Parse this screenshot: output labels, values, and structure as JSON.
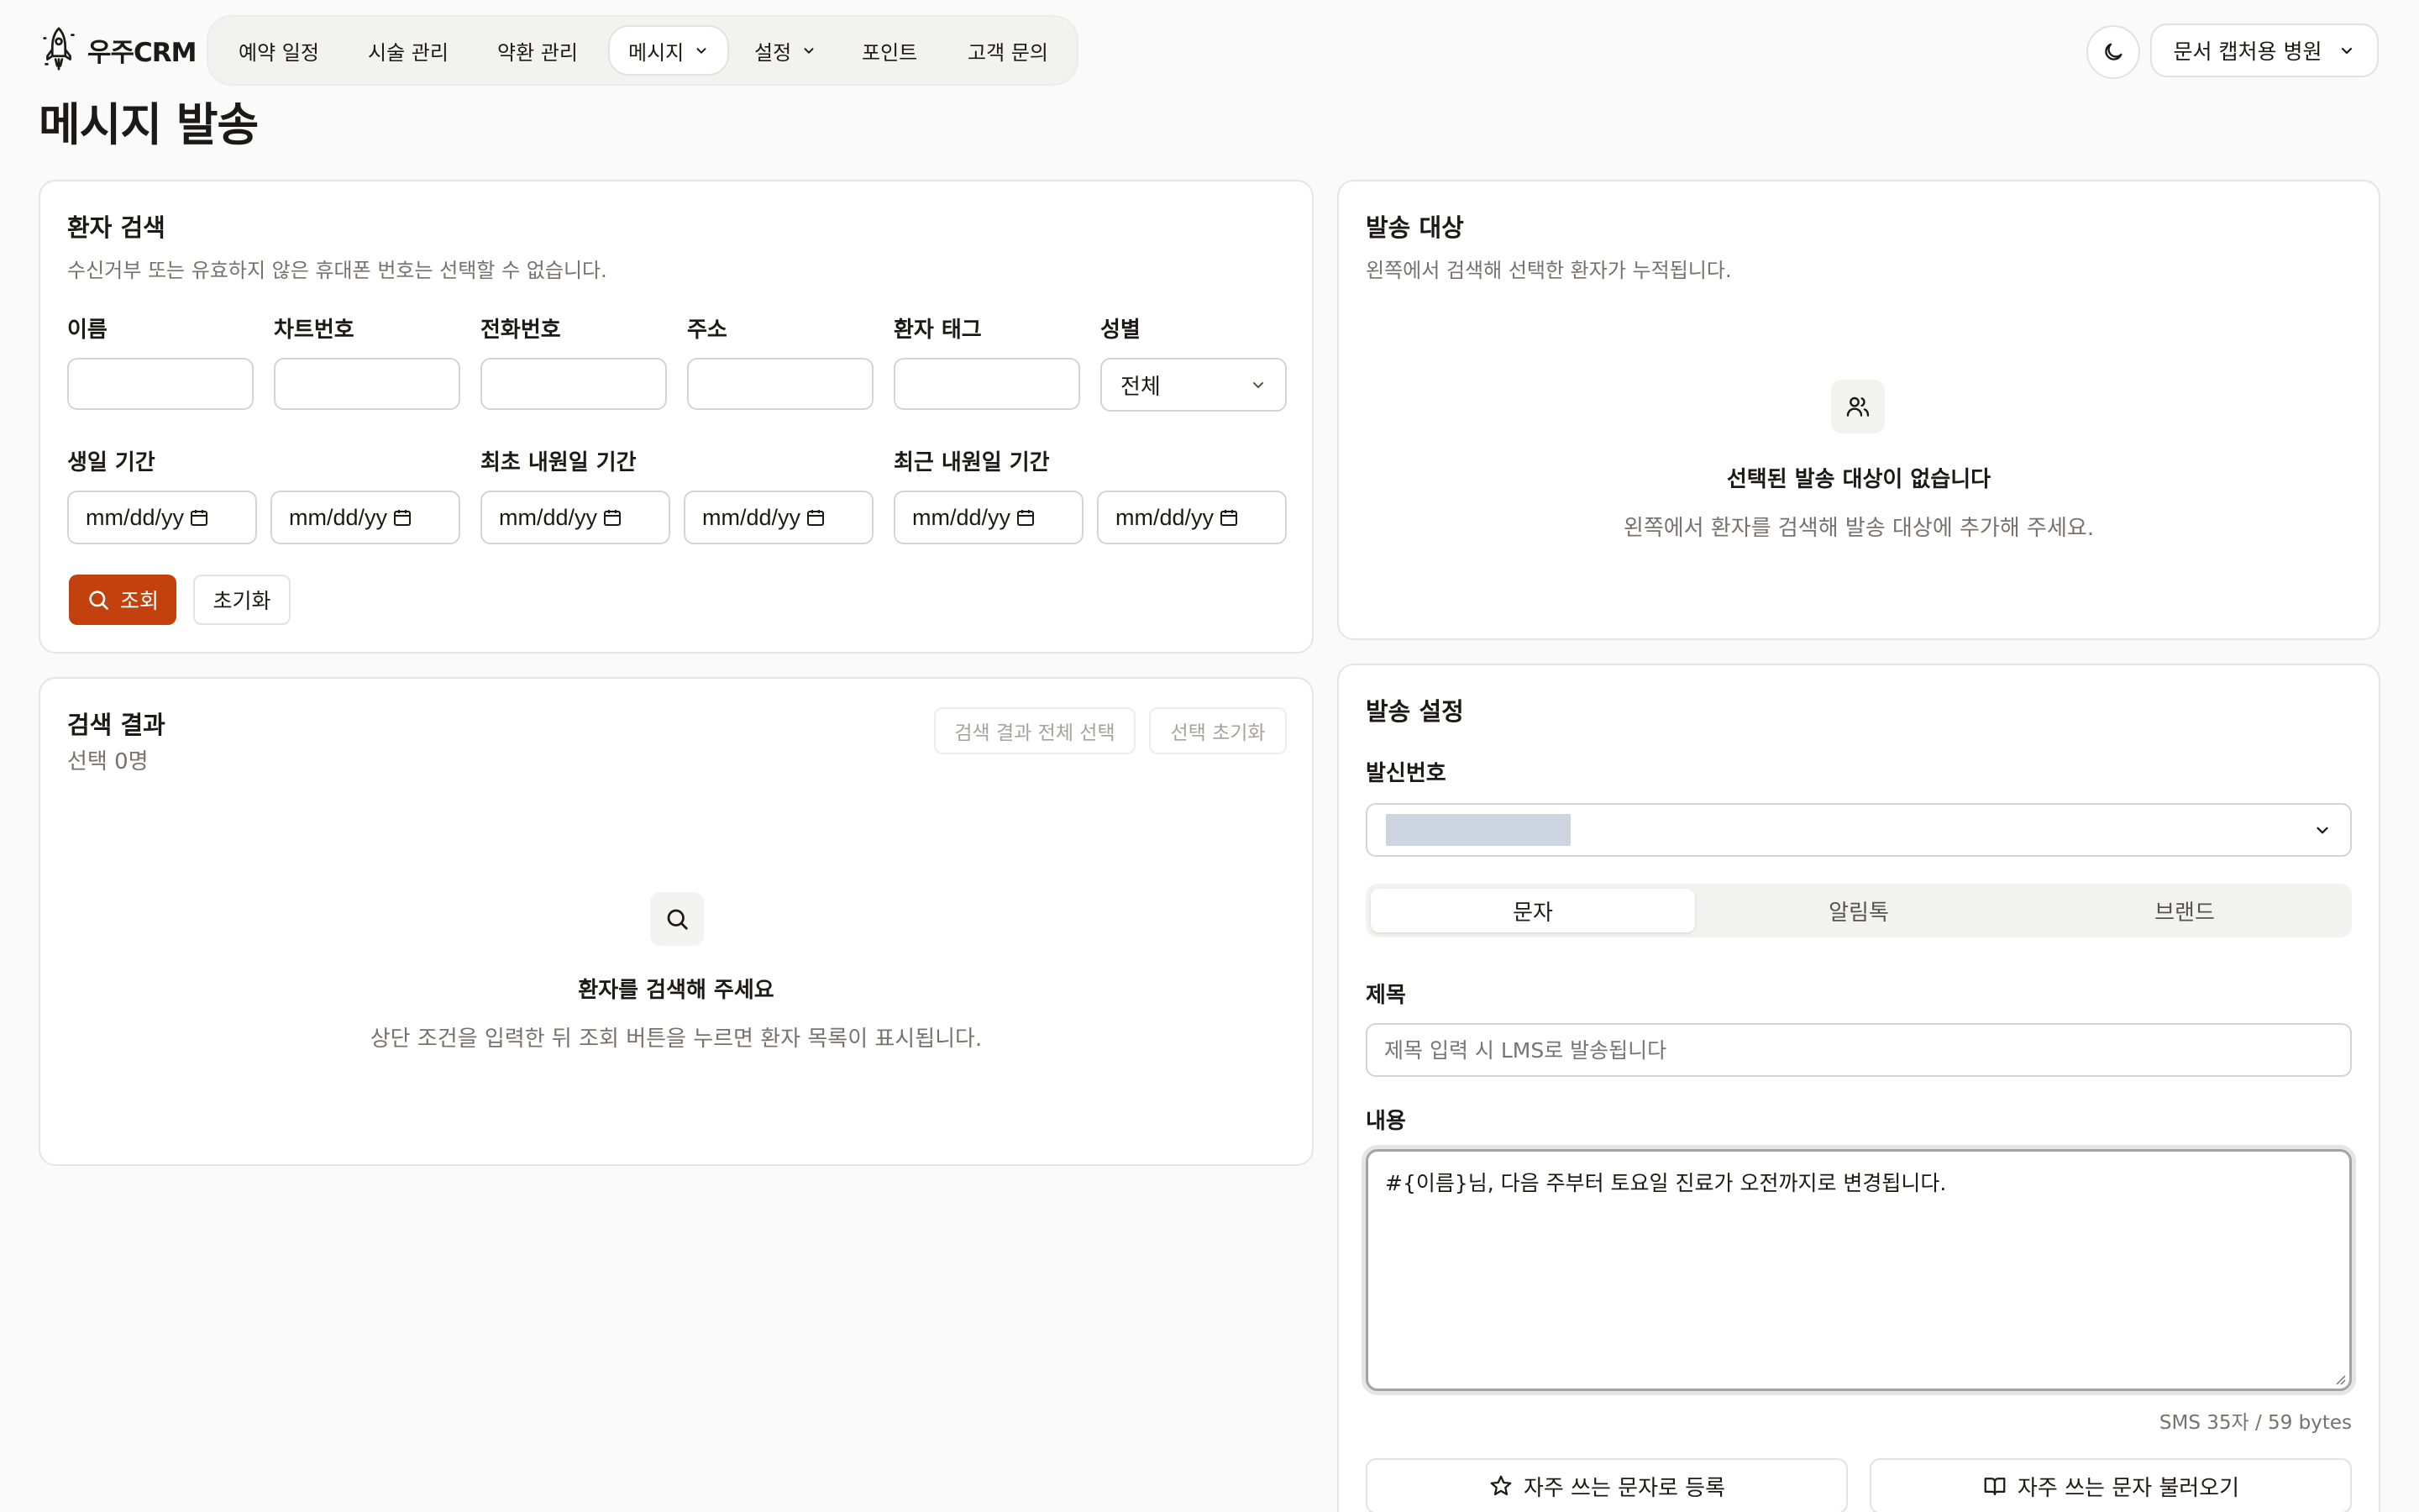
{
  "app": {
    "name": "우주CRM"
  },
  "nav": {
    "items": [
      {
        "label": "예약 일정"
      },
      {
        "label": "시술 관리"
      },
      {
        "label": "약환 관리"
      },
      {
        "label": "메시지"
      },
      {
        "label": "설정"
      },
      {
        "label": "포인트"
      },
      {
        "label": "고객 문의"
      }
    ],
    "active": "메시지"
  },
  "header": {
    "hospital": "문서 캡처용 병원"
  },
  "page": {
    "title": "메시지 발송"
  },
  "search_panel": {
    "title": "환자 검색",
    "subtitle": "수신거부 또는 유효하지 않은 휴대폰 번호는 선택할 수 없습니다.",
    "fields": {
      "name": "이름",
      "chart_no": "차트번호",
      "phone": "전화번호",
      "address": "주소",
      "tag": "환자 태그",
      "gender": "성별",
      "gender_value": "전체",
      "birthday_range": "생일 기간",
      "first_visit_range": "최초 내원일 기간",
      "last_visit_range": "최근 내원일 기간"
    },
    "date_placeholder": "mm/dd/yy",
    "search_button": "조회",
    "reset_button": "초기화"
  },
  "results_panel": {
    "title": "검색 결과",
    "selected_count": "선택 0명",
    "select_all_button": "검색 결과 전체 선택",
    "clear_selection_button": "선택 초기화",
    "empty_title": "환자를 검색해 주세요",
    "empty_desc": "상단 조건을 입력한 뒤 조회 버튼을 누르면 환자 목록이 표시됩니다."
  },
  "targets_panel": {
    "title": "발송 대상",
    "subtitle": "왼쪽에서 검색해 선택한 환자가 누적됩니다.",
    "empty_title": "선택된 발송 대상이 없습니다",
    "empty_desc": "왼쪽에서 환자를 검색해 발송 대상에 추가해 주세요."
  },
  "settings_panel": {
    "title": "발송 설정",
    "sender_label": "발신번호",
    "tabs": [
      {
        "label": "문자"
      },
      {
        "label": "알림톡"
      },
      {
        "label": "브랜드"
      }
    ],
    "active_tab": "문자",
    "subject_label": "제목",
    "subject_placeholder": "제목 입력 시 LMS로 발송됩니다",
    "content_label": "내용",
    "content_value": "#{이름}님, 다음 주부터 토요일 진료가 오전까지로 변경됩니다.",
    "counter": "SMS 35자 / 59 bytes",
    "save_template_button": "자주 쓰는 문자로 등록",
    "load_template_button": "자주 쓰는 문자 불러오기"
  },
  "colors": {
    "accent": "#c2410c",
    "background": "#fafafa",
    "border": "#e7e5e4",
    "muted_text": "#78716c"
  },
  "icons": {
    "logo": "rocket-icon",
    "theme": "moon-icon",
    "search": "search-icon",
    "users": "users-icon",
    "calendar": "calendar-icon",
    "star": "star-icon",
    "book": "book-open-icon"
  }
}
